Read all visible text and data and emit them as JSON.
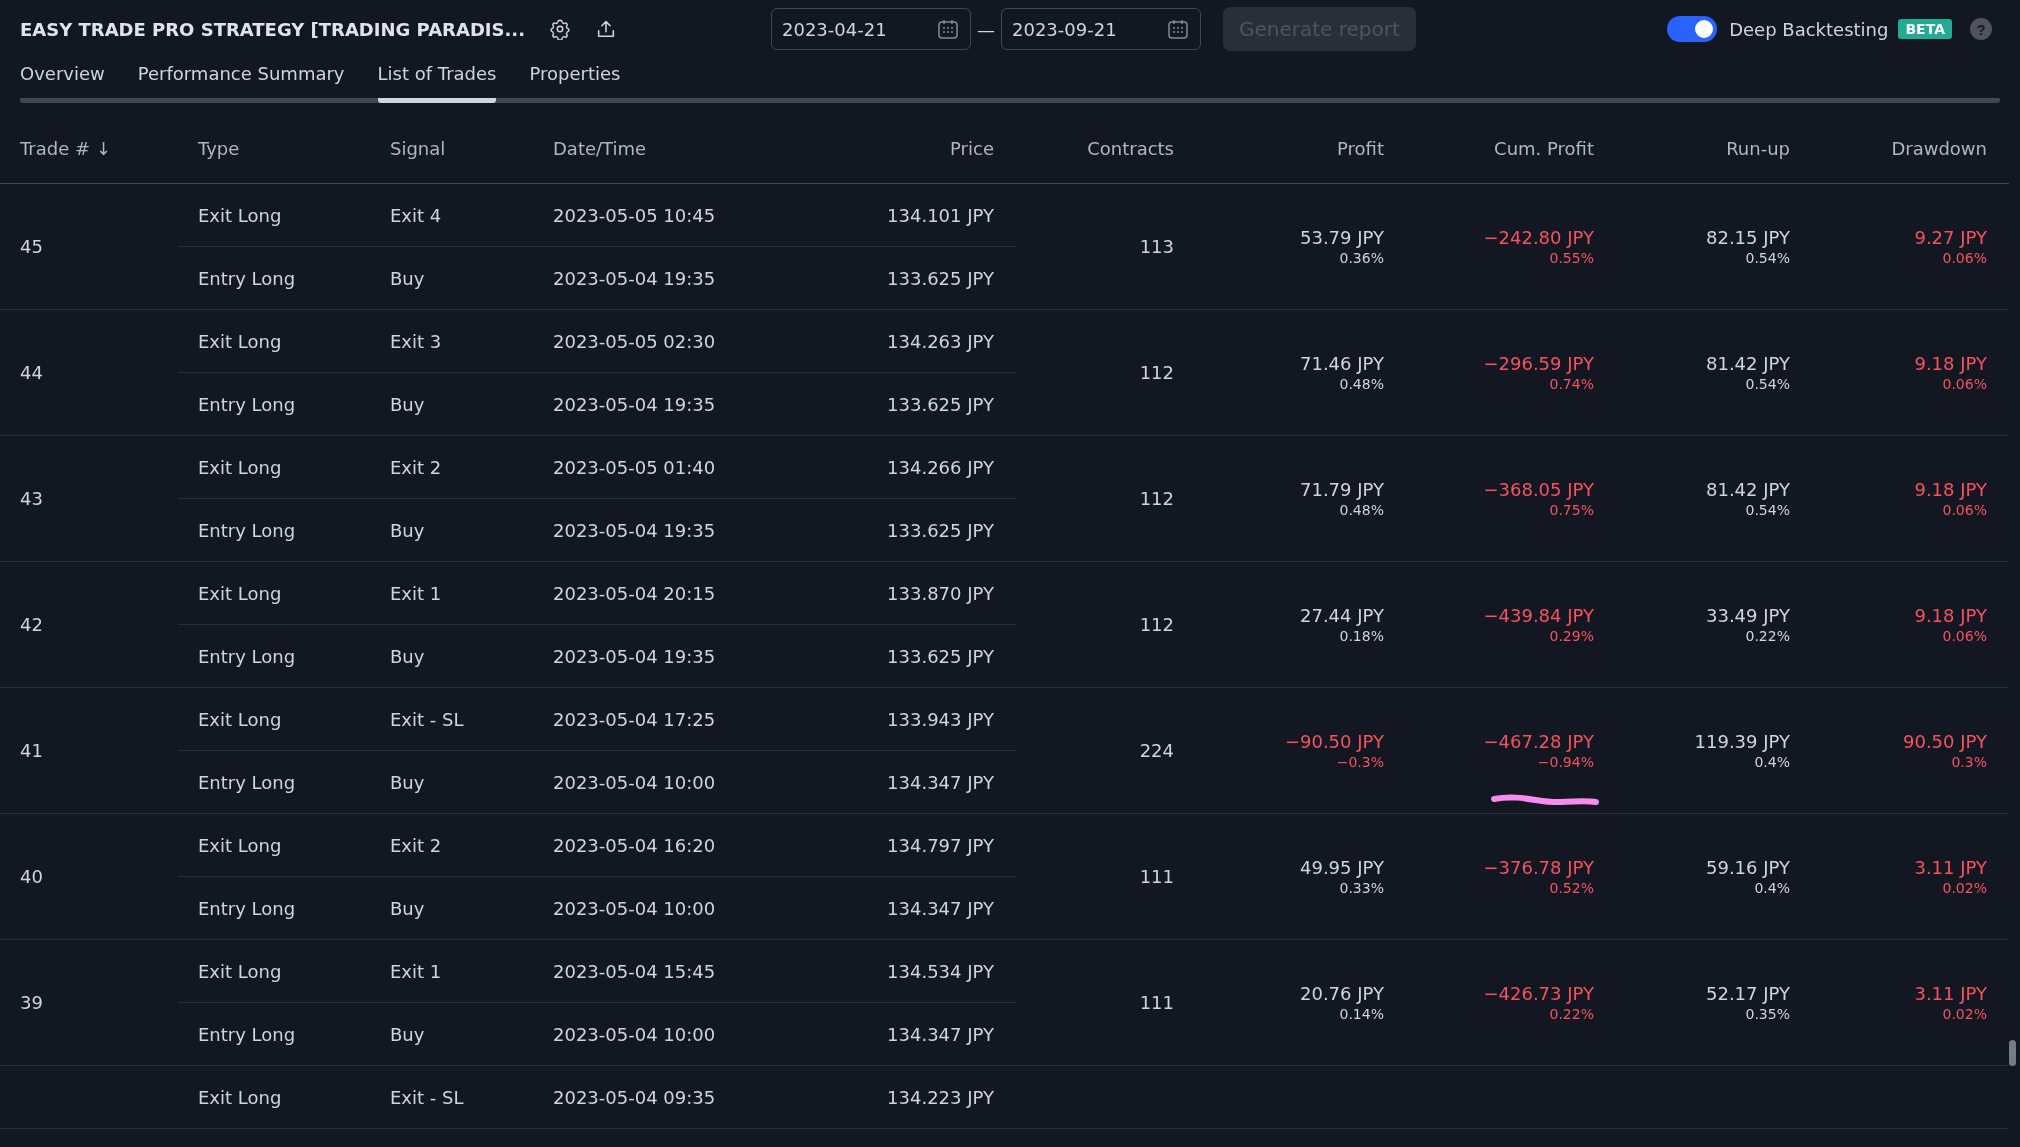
{
  "toolbar": {
    "title": "EASY TRADE PRO STRATEGY [TRADING PARADIS...",
    "date_from": "2023-04-21",
    "range_dash": "—",
    "date_to": "2023-09-21",
    "generate_button": {
      "label": "Generate report",
      "disabled": true
    },
    "deep_backtesting": {
      "label": "Deep Backtesting",
      "on": true,
      "badge": "BETA"
    },
    "help": "?"
  },
  "tabs": [
    {
      "label": "Overview",
      "selected": false
    },
    {
      "label": "Performance Summary",
      "selected": false
    },
    {
      "label": "List of Trades",
      "selected": true
    },
    {
      "label": "Properties",
      "selected": false
    }
  ],
  "columns": [
    {
      "label": "Trade #",
      "sort": "↓"
    },
    {
      "label": "Type"
    },
    {
      "label": "Signal"
    },
    {
      "label": "Date/Time"
    },
    {
      "label": "Price"
    },
    {
      "label": "Contracts"
    },
    {
      "label": "Profit"
    },
    {
      "label": "Cum. Profit"
    },
    {
      "label": "Run-up"
    },
    {
      "label": "Drawdown"
    }
  ],
  "trades": [
    {
      "number": "45",
      "contracts": "113",
      "profit": {
        "value": "53.79 JPY",
        "pct": "0.36%",
        "adverse": false
      },
      "cum_profit": {
        "value": "−242.80 JPY",
        "pct": "0.55%",
        "adverse": true
      },
      "run_up": {
        "value": "82.15 JPY",
        "pct": "0.54%",
        "adverse": false
      },
      "drawdown": {
        "value": "9.27 JPY",
        "pct": "0.06%",
        "adverse": true
      },
      "legs": [
        {
          "type": "Exit Long",
          "signal": "Exit 4",
          "datetime": "2023-05-05 10:45",
          "price": "134.101 JPY"
        },
        {
          "type": "Entry Long",
          "signal": "Buy",
          "datetime": "2023-05-04 19:35",
          "price": "133.625 JPY"
        }
      ]
    },
    {
      "number": "44",
      "contracts": "112",
      "profit": {
        "value": "71.46 JPY",
        "pct": "0.48%",
        "adverse": false
      },
      "cum_profit": {
        "value": "−296.59 JPY",
        "pct": "0.74%",
        "adverse": true
      },
      "run_up": {
        "value": "81.42 JPY",
        "pct": "0.54%",
        "adverse": false
      },
      "drawdown": {
        "value": "9.18 JPY",
        "pct": "0.06%",
        "adverse": true
      },
      "legs": [
        {
          "type": "Exit Long",
          "signal": "Exit 3",
          "datetime": "2023-05-05 02:30",
          "price": "134.263 JPY"
        },
        {
          "type": "Entry Long",
          "signal": "Buy",
          "datetime": "2023-05-04 19:35",
          "price": "133.625 JPY"
        }
      ]
    },
    {
      "number": "43",
      "contracts": "112",
      "profit": {
        "value": "71.79 JPY",
        "pct": "0.48%",
        "adverse": false
      },
      "cum_profit": {
        "value": "−368.05 JPY",
        "pct": "0.75%",
        "adverse": true
      },
      "run_up": {
        "value": "81.42 JPY",
        "pct": "0.54%",
        "adverse": false
      },
      "drawdown": {
        "value": "9.18 JPY",
        "pct": "0.06%",
        "adverse": true
      },
      "legs": [
        {
          "type": "Exit Long",
          "signal": "Exit 2",
          "datetime": "2023-05-05 01:40",
          "price": "134.266 JPY"
        },
        {
          "type": "Entry Long",
          "signal": "Buy",
          "datetime": "2023-05-04 19:35",
          "price": "133.625 JPY"
        }
      ]
    },
    {
      "number": "42",
      "contracts": "112",
      "profit": {
        "value": "27.44 JPY",
        "pct": "0.18%",
        "adverse": false
      },
      "cum_profit": {
        "value": "−439.84 JPY",
        "pct": "0.29%",
        "adverse": true
      },
      "run_up": {
        "value": "33.49 JPY",
        "pct": "0.22%",
        "adverse": false
      },
      "drawdown": {
        "value": "9.18 JPY",
        "pct": "0.06%",
        "adverse": true
      },
      "legs": [
        {
          "type": "Exit Long",
          "signal": "Exit 1",
          "datetime": "2023-05-04 20:15",
          "price": "133.870 JPY"
        },
        {
          "type": "Entry Long",
          "signal": "Buy",
          "datetime": "2023-05-04 19:35",
          "price": "133.625 JPY"
        }
      ]
    },
    {
      "number": "41",
      "contracts": "224",
      "profit": {
        "value": "−90.50 JPY",
        "pct": "−0.3%",
        "adverse": true
      },
      "cum_profit": {
        "value": "−467.28 JPY",
        "pct": "−0.94%",
        "adverse": true,
        "marked": true
      },
      "run_up": {
        "value": "119.39 JPY",
        "pct": "0.4%",
        "adverse": false
      },
      "drawdown": {
        "value": "90.50 JPY",
        "pct": "0.3%",
        "adverse": true
      },
      "legs": [
        {
          "type": "Exit Long",
          "signal": "Exit - SL",
          "datetime": "2023-05-04 17:25",
          "price": "133.943 JPY"
        },
        {
          "type": "Entry Long",
          "signal": "Buy",
          "datetime": "2023-05-04 10:00",
          "price": "134.347 JPY"
        }
      ]
    },
    {
      "number": "40",
      "contracts": "111",
      "profit": {
        "value": "49.95 JPY",
        "pct": "0.33%",
        "adverse": false
      },
      "cum_profit": {
        "value": "−376.78 JPY",
        "pct": "0.52%",
        "adverse": true
      },
      "run_up": {
        "value": "59.16 JPY",
        "pct": "0.4%",
        "adverse": false
      },
      "drawdown": {
        "value": "3.11 JPY",
        "pct": "0.02%",
        "adverse": true
      },
      "legs": [
        {
          "type": "Exit Long",
          "signal": "Exit 2",
          "datetime": "2023-05-04 16:20",
          "price": "134.797 JPY"
        },
        {
          "type": "Entry Long",
          "signal": "Buy",
          "datetime": "2023-05-04 10:00",
          "price": "134.347 JPY"
        }
      ]
    },
    {
      "number": "39",
      "contracts": "111",
      "profit": {
        "value": "20.76 JPY",
        "pct": "0.14%",
        "adverse": false
      },
      "cum_profit": {
        "value": "−426.73 JPY",
        "pct": "0.22%",
        "adverse": true
      },
      "run_up": {
        "value": "52.17 JPY",
        "pct": "0.35%",
        "adverse": false
      },
      "drawdown": {
        "value": "3.11 JPY",
        "pct": "0.02%",
        "adverse": true
      },
      "legs": [
        {
          "type": "Exit Long",
          "signal": "Exit 1",
          "datetime": "2023-05-04 15:45",
          "price": "134.534 JPY"
        },
        {
          "type": "Entry Long",
          "signal": "Buy",
          "datetime": "2023-05-04 10:00",
          "price": "134.347 JPY"
        }
      ]
    },
    {
      "legs": [
        {
          "type": "Exit Long",
          "signal": "Exit - SL",
          "datetime": "2023-05-04 09:35",
          "price": "134.223 JPY"
        }
      ]
    }
  ]
}
